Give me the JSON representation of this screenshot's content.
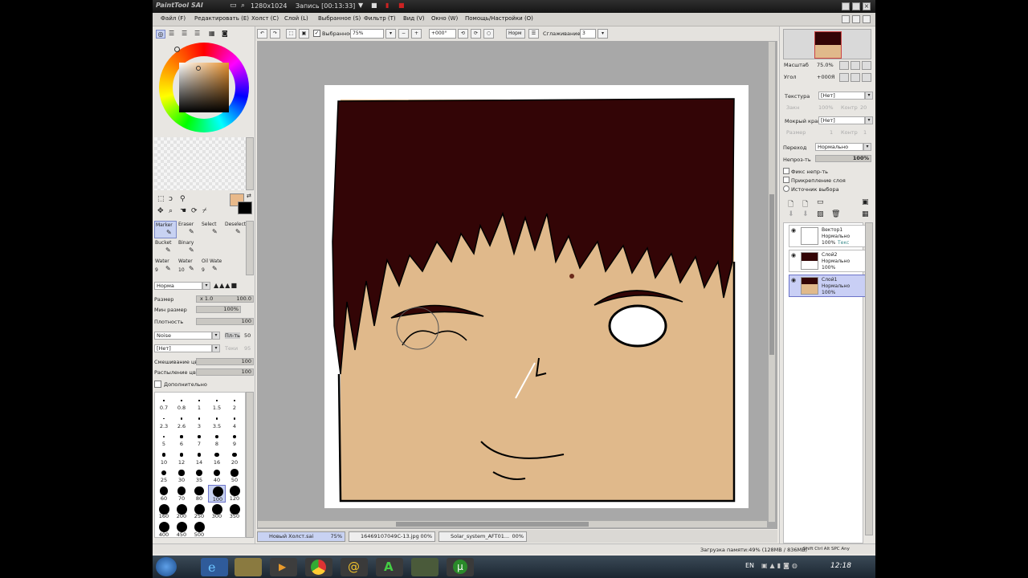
{
  "window": {
    "app_name": "PaintTool SAI",
    "resolution": "1280x1024",
    "recording": "Запись [00:13:33]"
  },
  "menu": [
    "Файл (F)",
    "Редактировать (E)",
    "Холст (C)",
    "Слой (L)",
    "Выбранное (S)",
    "Фильтр (T)",
    "Вид (V)",
    "Окно (W)",
    "Помощь/Настройки (O)"
  ],
  "toolbar": {
    "selection_checkbox": "Выбранное",
    "zoom": "75%",
    "angle": "+000°",
    "blend": "Норм",
    "smoothing_label": "Сглаживание",
    "smoothing_value": "3"
  },
  "tools": [
    {
      "name": "Marker",
      "size": ""
    },
    {
      "name": "Eraser",
      "size": ""
    },
    {
      "name": "Select",
      "size": ""
    },
    {
      "name": "Deselect",
      "size": ""
    },
    {
      "name": "Bucket",
      "size": ""
    },
    {
      "name": "Binary",
      "size": ""
    },
    {
      "name": "",
      "size": ""
    },
    {
      "name": "",
      "size": ""
    },
    {
      "name": "Water",
      "size": "9"
    },
    {
      "name": "Water",
      "size": "10"
    },
    {
      "name": "Oil Wate",
      "size": "9"
    },
    {
      "name": "",
      "size": ""
    }
  ],
  "brush": {
    "mode": "Норма",
    "size_label": "Размер",
    "size_mult": "x 1.0",
    "size_value": "100.0",
    "min_size_label": "Мин размер",
    "min_size_value": "100%",
    "density_label": "Плотность",
    "density_value": "100",
    "texture": "Noise",
    "texture_strength_label": "Пл-ть",
    "texture_strength": "50",
    "shape": "[Нет]",
    "shape_strength_label": "Теки",
    "shape_strength": "95",
    "mixing_label": "Смешивание цвет",
    "mixing_value": "100",
    "spray_label": "Распыление цвет",
    "spray_value": "100",
    "advanced_label": "Дополнительно"
  },
  "brush_sizes": [
    "0.7",
    "0.8",
    "1",
    "1.5",
    "2",
    "2.3",
    "2.6",
    "3",
    "3.5",
    "4",
    "5",
    "6",
    "7",
    "8",
    "9",
    "10",
    "12",
    "14",
    "16",
    "20",
    "25",
    "30",
    "35",
    "40",
    "50",
    "60",
    "70",
    "80",
    "100",
    "120",
    "160",
    "200",
    "250",
    "300",
    "350",
    "400",
    "450",
    "500"
  ],
  "navigator": {
    "zoom_label": "Масштаб",
    "zoom_value": "75.0%",
    "angle_label": "Угол",
    "angle_value": "+000Я"
  },
  "layer_props": {
    "texture_label": "Текстура",
    "texture_value": "[Нет]",
    "texture_scale_label": "Закн",
    "texture_scale_value": "100%",
    "texture_strength_label": "Контр",
    "texture_strength_value": "20",
    "wet_edge_label": "Мокрый край",
    "wet_edge_value": "[Нет]",
    "wet_size_label": "Размер",
    "wet_size_value": "1",
    "wet_strength_label": "Контр",
    "wet_strength_value": "1",
    "blend_label": "Переход",
    "blend_value": "Нормально",
    "opacity_label": "Непроз-ть",
    "opacity_value": "100%",
    "preserve_opacity": "Фикс непр-ть",
    "clipping": "Прикрепление слоя",
    "selection_source": "Источник выбора"
  },
  "layers": [
    {
      "name": "Вектор1",
      "mode": "Нормально",
      "opacity": "100%",
      "extra": "Текс"
    },
    {
      "name": "Слой2",
      "mode": "Нормально",
      "opacity": "100%",
      "extra": ""
    },
    {
      "name": "Слой1",
      "mode": "Нормально",
      "opacity": "100%",
      "extra": ""
    }
  ],
  "documents": [
    {
      "name": "Новый Холст.sai",
      "zoom": "75%"
    },
    {
      "name": "16469107049C-13.jpg",
      "zoom": "00%"
    },
    {
      "name": "Solar_system_AFT01...",
      "zoom": "00%"
    }
  ],
  "status": {
    "memory": "Загрузка памяти:49% (128MB / 836MB)",
    "keys": "Shift Ctrl Alt SPC Any"
  },
  "taskbar": {
    "lang": "EN",
    "time": "12:18"
  },
  "colors": {
    "primary": "#e8b98a",
    "secondary": "#000000",
    "skin": "#e0b98b",
    "hair": "#300404"
  }
}
